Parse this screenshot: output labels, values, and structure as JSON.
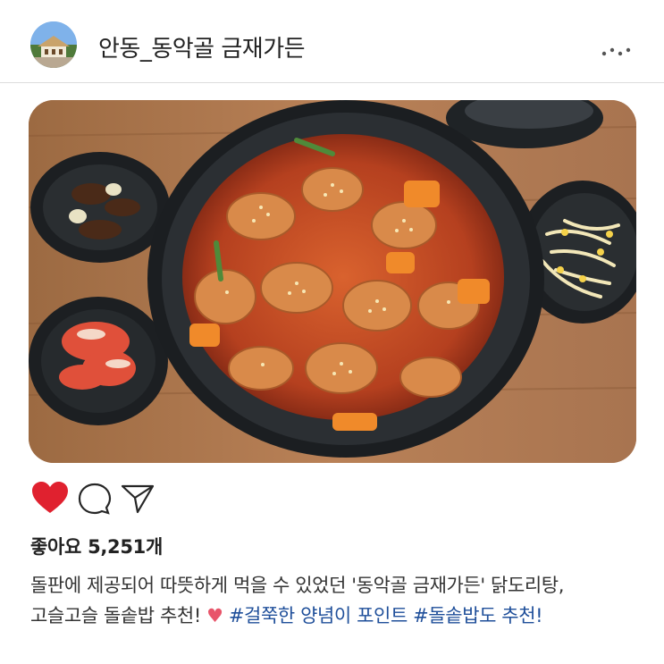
{
  "post": {
    "username": "안동_동악골 금재가든",
    "likes_text": "좋아요 5,251개",
    "liked": true,
    "caption": {
      "line1": "돌판에 제공되어 따뜻하게 먹을 수 있었던 '동악골 금재가든' 닭도리탕,",
      "line2_text": "고슬고슬 돌솥밥 추천! ",
      "emoji": "♥",
      "hashtags": [
        "#걸쭉한 양념이 포인트",
        "#돌솥밥도 추천!"
      ]
    }
  },
  "icons": {
    "avatar": "avatar-image",
    "more": "more-options-icon",
    "like": "heart-filled-icon",
    "comment": "comment-icon",
    "share": "share-send-icon"
  },
  "colors": {
    "like": "#e0212f",
    "hashtag": "#1f4f9a",
    "text": "#333333"
  }
}
